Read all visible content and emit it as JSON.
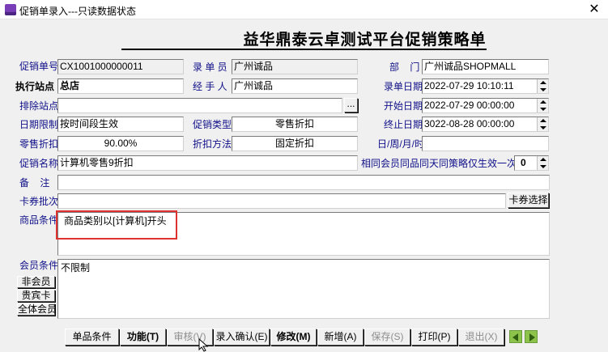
{
  "window": {
    "title": "促销单录入---只读数据状态",
    "close_glyph": "✕"
  },
  "form_title": "益华鼎泰云卓测试平台促销策略单",
  "fields": {
    "promo_no": {
      "label": "促销单号",
      "value": "CX1001000000011"
    },
    "recorder": {
      "label": "录 单 员",
      "value": "广州诚品"
    },
    "dept": {
      "label": "部    门",
      "value": "广州诚品SHOPMALL"
    },
    "exec_site": {
      "label": "执行站点",
      "value": "总店"
    },
    "handler": {
      "label": "经 手 人",
      "value": "广州诚品"
    },
    "record_date": {
      "label": "录单日期",
      "value": "2022-07-29 10:10:11"
    },
    "exclude_site": {
      "label": "排除站点",
      "value": "",
      "button": "..."
    },
    "start_date": {
      "label": "开始日期",
      "value": "2022-07-29 00:00:00"
    },
    "date_limit": {
      "label": "日期限制",
      "value": "按时间段生效"
    },
    "promo_type": {
      "label": "促销类型",
      "value": "零售折扣"
    },
    "end_date": {
      "label": "终止日期",
      "value": "3022-08-28 00:00:00"
    },
    "retail_discount": {
      "label": "零售折扣",
      "value": "90.00%"
    },
    "discount_method": {
      "label": "折扣方法",
      "value": "固定折扣"
    },
    "period": {
      "label": "日/周/月/时",
      "value": ""
    },
    "promo_name": {
      "label": "促销名称",
      "value": "计算机零售9折扣"
    },
    "same_member_rule": {
      "label": "相同会员同品同天同策略仅生效一次",
      "value": "0"
    },
    "remark": {
      "label": "备    注",
      "value": ""
    },
    "coupon_batch": {
      "label": "卡券批次",
      "value": "",
      "button": "卡券选择"
    },
    "goods_condition": {
      "label": "商品条件",
      "value": "商品类别以[计算机]开头"
    },
    "member_condition": {
      "label": "会员条件",
      "value": "不限制",
      "buttons": [
        "非会员",
        "贵宾卡",
        "全体会员"
      ]
    }
  },
  "toolbar": {
    "buttons": [
      {
        "label": "单品条件",
        "enabled": true,
        "bold": false
      },
      {
        "label": "功能(T)",
        "enabled": true,
        "bold": true
      },
      {
        "label": "审核(V)",
        "enabled": false,
        "bold": false
      },
      {
        "label": "录入确认(E)",
        "enabled": true,
        "bold": false
      },
      {
        "label": "修改(M)",
        "enabled": true,
        "bold": true
      },
      {
        "label": "新增(A)",
        "enabled": true,
        "bold": false
      },
      {
        "label": "保存(S)",
        "enabled": false,
        "bold": false
      },
      {
        "label": "打印(P)",
        "enabled": true,
        "bold": false
      },
      {
        "label": "退出(X)",
        "enabled": false,
        "bold": false
      }
    ]
  },
  "colors": {
    "label": "#10108a",
    "highlight": "#e03131",
    "nav": "#8cc34a"
  }
}
